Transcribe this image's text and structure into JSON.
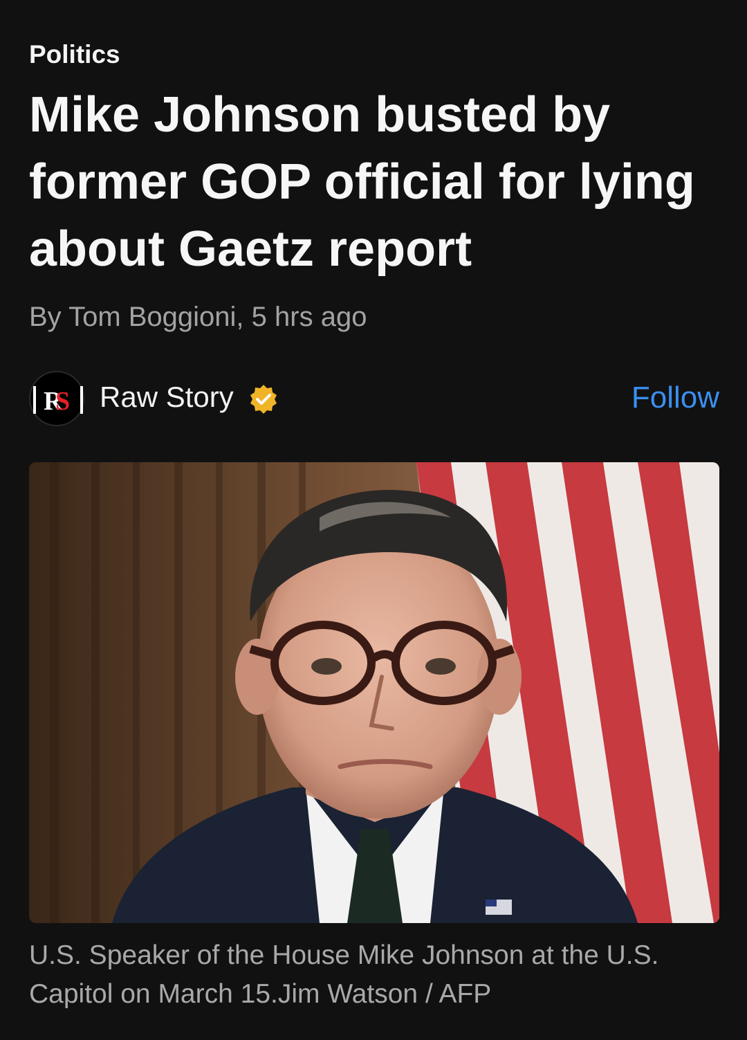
{
  "article": {
    "category": "Politics",
    "headline": "Mike Johnson busted by former GOP official for lying about Gaetz report",
    "byline": "By Tom Boggioni, 5 hrs ago",
    "source": {
      "logo_text": "RS",
      "name": "Raw Story",
      "verified_icon": "verified-badge-icon",
      "follow_label": "Follow"
    },
    "image": {
      "description_icon": "article-photo"
    },
    "caption": "U.S. Speaker of the House Mike Johnson at the U.S. Capitol on March 15.Jim Watson / AFP"
  },
  "colors": {
    "background": "#111112",
    "accent": "#3b8ff0",
    "muted_text": "#a3a3a3",
    "verified_badge": "#f0b429"
  }
}
